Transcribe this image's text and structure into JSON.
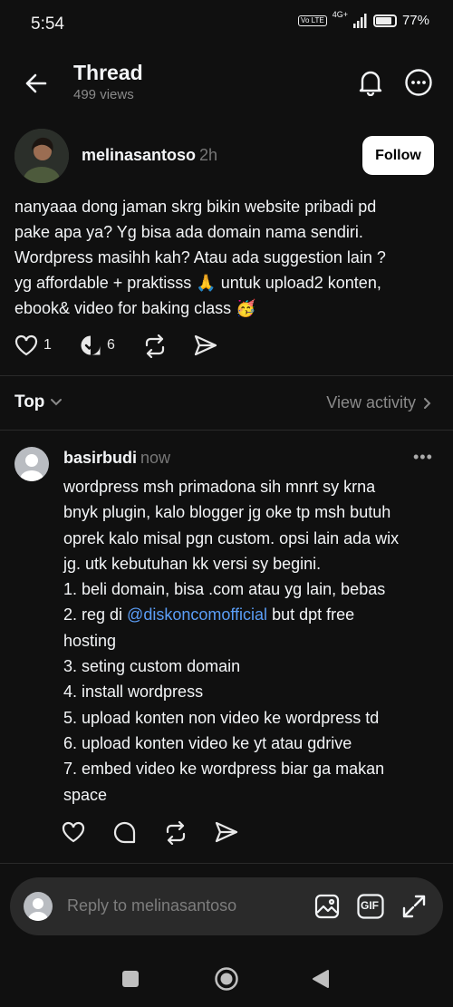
{
  "status": {
    "time": "5:54",
    "network": "4G+",
    "volte": "Vo LTE",
    "battery": "77%",
    "battery_level": 0.77
  },
  "header": {
    "title": "Thread",
    "views": "499 views"
  },
  "post": {
    "author": "melinasantoso",
    "time": "2h",
    "follow_label": "Follow",
    "lines": [
      "nanyaaa dong jaman skrg bikin website pribadi pd",
      "pake apa ya? Yg bisa ada domain nama sendiri.",
      "Wordpress masihh kah? Atau ada suggestion lain ?",
      "yg affordable + praktisss 🙏 untuk upload2 konten,",
      "ebook& video for baking class 🥳"
    ],
    "likes": "1",
    "replies": "6"
  },
  "sort": {
    "label": "Top",
    "view_activity": "View activity"
  },
  "reply": {
    "author": "basirbudi",
    "time": "now",
    "more": "•••",
    "lines": [
      "wordpress msh primadona sih mnrt sy krna",
      "bnyk plugin, kalo blogger jg oke tp msh butuh",
      "oprek kalo misal pgn custom. opsi lain ada wix",
      "jg. utk kebutuhan kk versi sy begini.",
      "1. beli domain, bisa .com atau yg lain, bebas"
    ],
    "line6_before": "2. reg di ",
    "mention": "@diskoncomofficial",
    "line6_after": " but dpt free",
    "lines_after": [
      "hosting",
      "3. seting custom domain",
      "4. install wordpress",
      "5. upload konten non video ke wordpress td",
      "6. upload konten video ke yt atau gdrive",
      "7. embed video ke wordpress biar ga makan",
      "space"
    ]
  },
  "reply_bar": {
    "placeholder": "Reply to melinasantoso",
    "gif_label": "GIF"
  },
  "colors": {
    "background": "#101010",
    "mention": "#5b9ef7",
    "muted": "#8a8a8a"
  }
}
